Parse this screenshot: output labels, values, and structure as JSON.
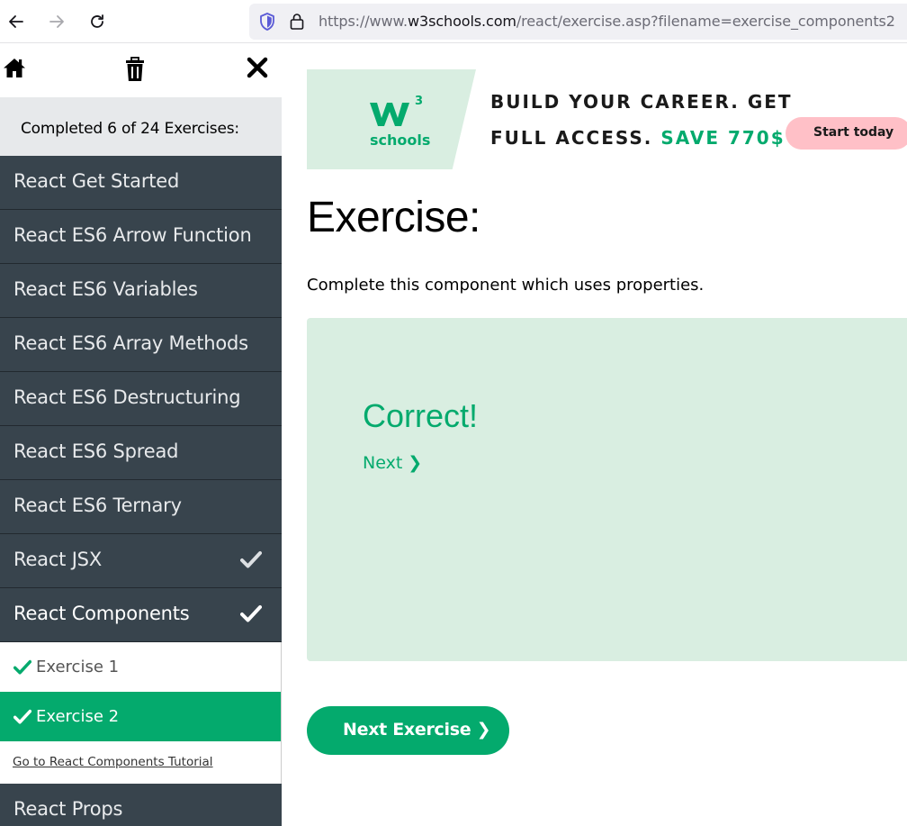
{
  "browser": {
    "url_prefix": "https://www.",
    "url_host": "w3schools.com",
    "url_path": "/react/exercise.asp?filename=exercise_components2"
  },
  "sidebar": {
    "progress": "Completed 6 of 24 Exercises:",
    "categories_top": [
      {
        "label": "React Get Started",
        "done": false
      },
      {
        "label": "React ES6 Arrow Function",
        "done": false
      },
      {
        "label": "React ES6 Variables",
        "done": false
      },
      {
        "label": "React ES6 Array Methods",
        "done": false
      },
      {
        "label": "React ES6 Destructuring",
        "done": false
      },
      {
        "label": "React ES6 Spread",
        "done": false
      },
      {
        "label": "React ES6 Ternary",
        "done": false
      },
      {
        "label": "React JSX",
        "done": true
      },
      {
        "label": "React Components",
        "done": true
      }
    ],
    "sub_items": [
      {
        "label": "Exercise 1",
        "done": true,
        "current": false
      },
      {
        "label": "Exercise 2",
        "done": true,
        "current": true
      }
    ],
    "tutorial_link": "Go to React Components Tutorial",
    "categories_bottom": [
      {
        "label": "React Props",
        "done": false
      }
    ]
  },
  "ad": {
    "logo_text": "schools",
    "logo_sup": "3",
    "line1": "BUILD YOUR CAREER. GET",
    "line2_a": "FULL ACCESS.",
    "line2_b": "SAVE 770$",
    "button": "Start today"
  },
  "main": {
    "title": "Exercise:",
    "description": "Complete this component which uses properties.",
    "result_title": "Correct!",
    "result_next": "Next ❯",
    "next_button": "Next Exercise ❯"
  },
  "colors": {
    "accent": "#04aa6d",
    "sidebar_bg": "#38444d",
    "result_bg": "#d9eee1",
    "ad_button": "#ffc0c7"
  }
}
